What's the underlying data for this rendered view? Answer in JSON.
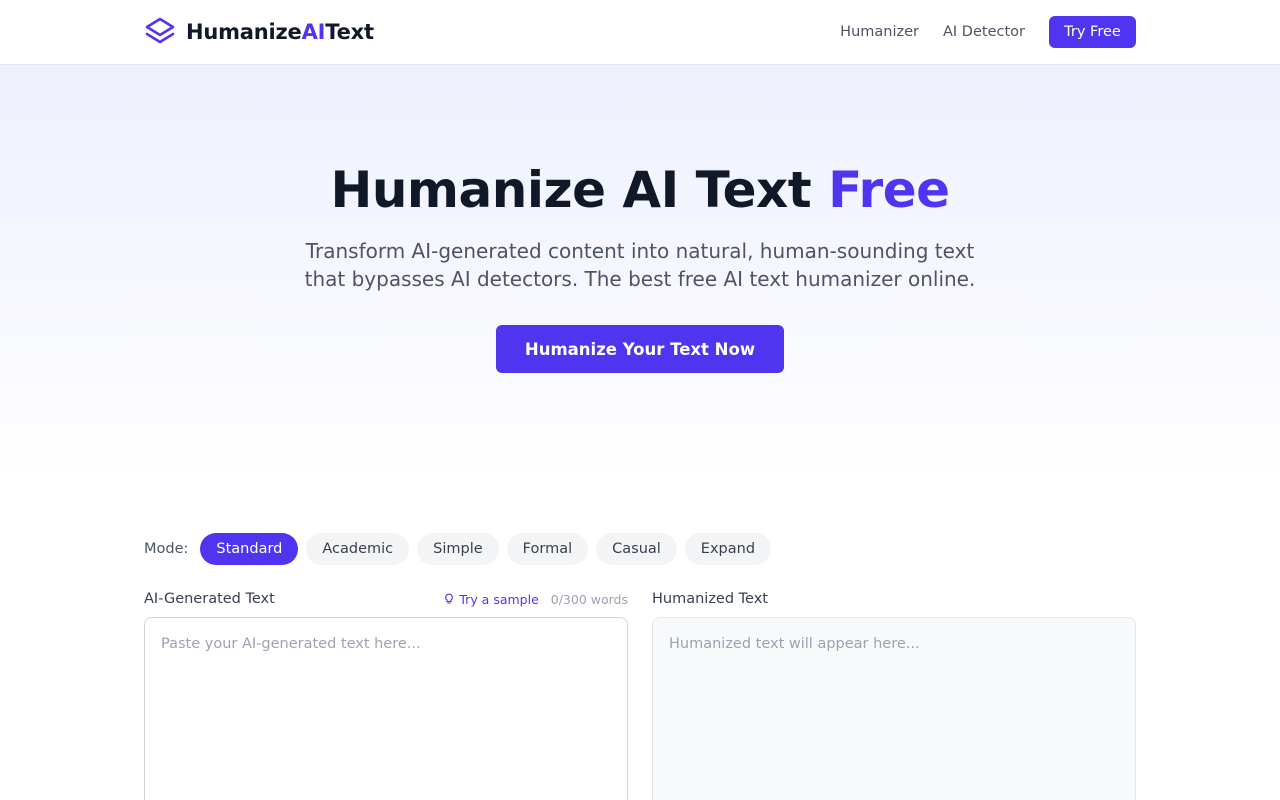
{
  "brand": {
    "name_part1": "Humanize",
    "name_part2": "AI",
    "name_part3": "Text",
    "logo_icon": "layers-icon"
  },
  "nav": {
    "links": [
      "Humanizer",
      "AI Detector"
    ],
    "cta_label": "Try Free"
  },
  "hero": {
    "title_main": "Humanize AI Text",
    "title_accent": "Free",
    "subtitle_line1": "Transform AI-generated content into natural, human-sounding text",
    "subtitle_line2": "that bypasses AI detectors. The best free AI text humanizer online.",
    "cta_label": "Humanize Your Text Now"
  },
  "modes": {
    "label": "Mode:",
    "options": [
      "Standard",
      "Academic",
      "Simple",
      "Formal",
      "Casual",
      "Expand"
    ],
    "selected": "Standard"
  },
  "input_panel": {
    "title": "AI-Generated Text",
    "sample_label": "Try a sample",
    "sample_icon": "lightbulb-icon",
    "word_count": "0/300 words",
    "value": "",
    "placeholder": "Paste your AI-generated text here..."
  },
  "output_panel": {
    "title": "Humanized Text",
    "placeholder": "Humanized text will appear here..."
  },
  "colors": {
    "accent": "#4f35f0",
    "text_dark": "#111827",
    "text_muted": "#4b5563"
  }
}
